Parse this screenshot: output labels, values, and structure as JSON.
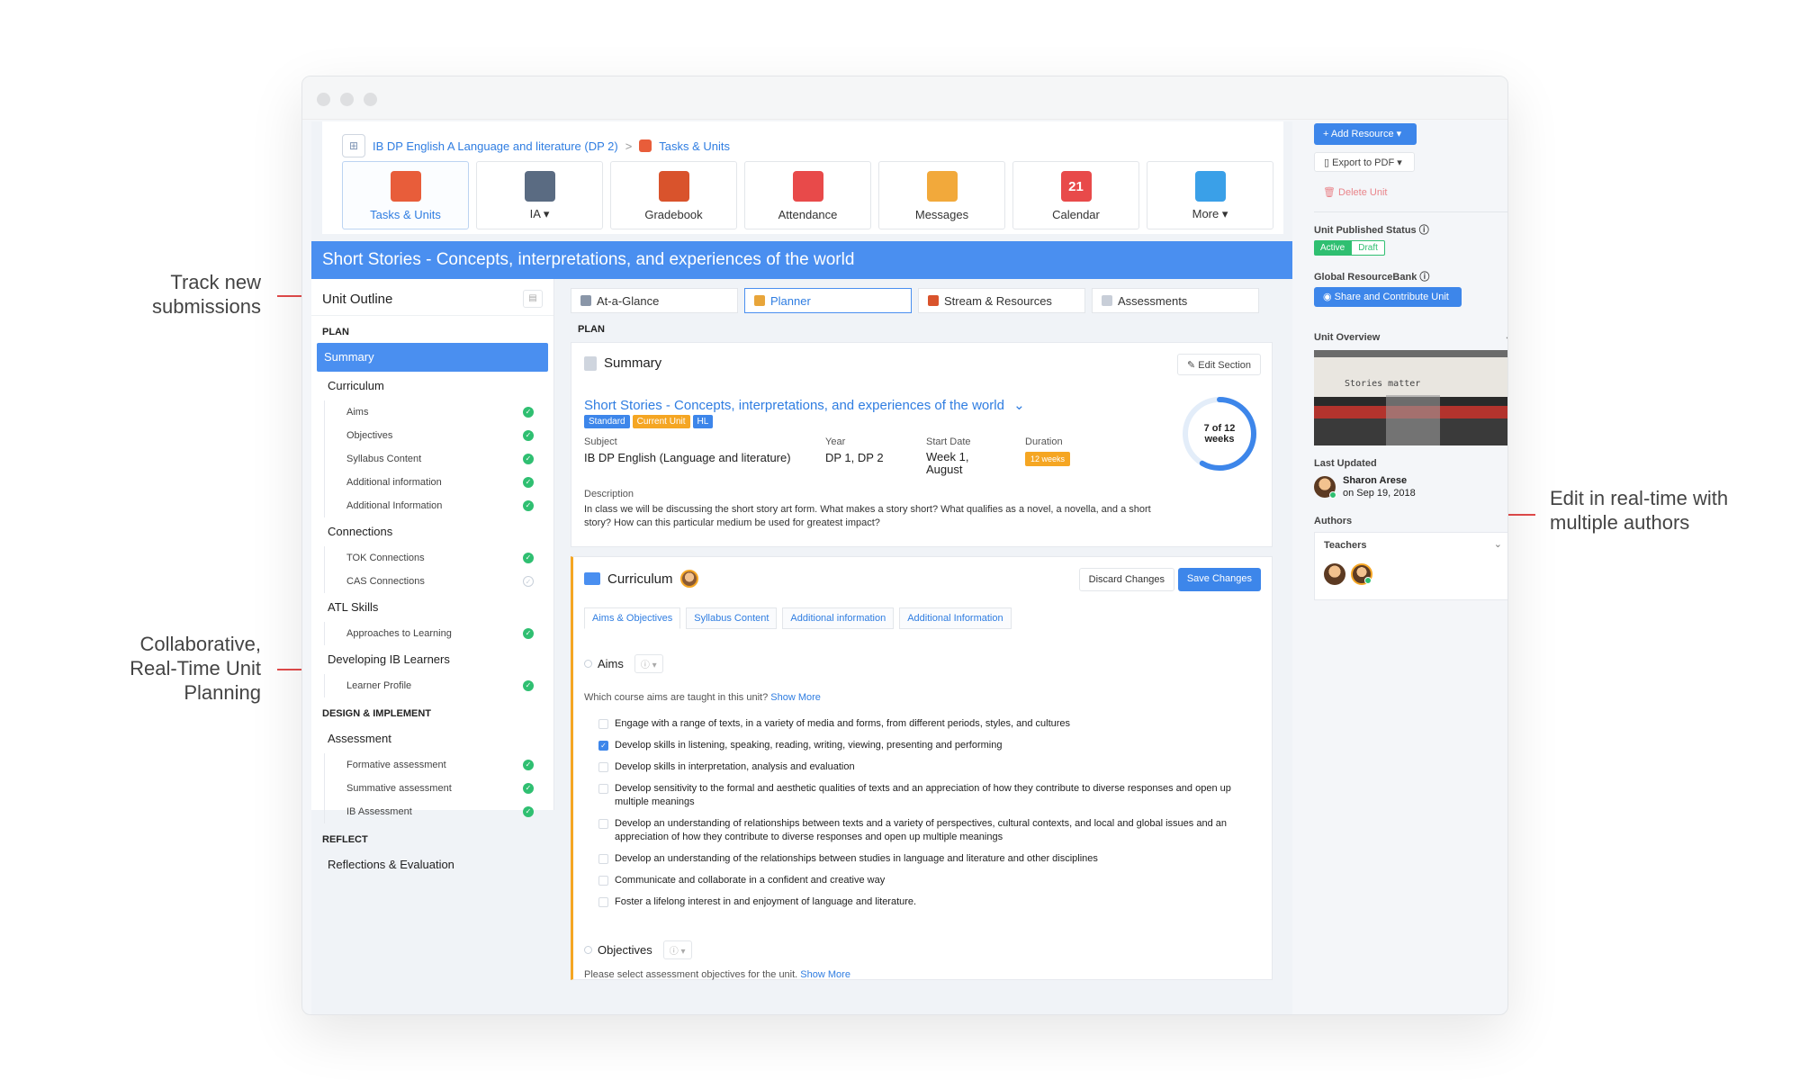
{
  "annotations": {
    "track": "Track new\nsubmissions",
    "collab": "Collaborative,\nReal-Time Unit\nPlanning",
    "edit": "Edit in real-time with\nmultiple authors"
  },
  "breadcrumb": {
    "course": "IB DP English A Language and literature (DP 2)",
    "separator": ">",
    "current": "Tasks & Units"
  },
  "nav_tiles": [
    {
      "label": "Tasks & Units",
      "icon": "puzzle-icon",
      "color": "#e85d3a",
      "active": true
    },
    {
      "label": "IA ▾",
      "icon": "notebook-icon",
      "color": "#5a6b82",
      "active": false
    },
    {
      "label": "Gradebook",
      "icon": "gradebook-icon",
      "color": "#d9532c",
      "active": false
    },
    {
      "label": "Attendance",
      "icon": "attendance-icon",
      "color": "#e84a4a",
      "active": false
    },
    {
      "label": "Messages",
      "icon": "envelope-icon",
      "color": "#f2a93b",
      "active": false
    },
    {
      "label": "Calendar",
      "icon": "calendar-icon",
      "color": "#e84a4a",
      "active": false,
      "glyph": "21"
    },
    {
      "label": "More ▾",
      "icon": "more-apps-icon",
      "color": "#3aa0e8",
      "active": false
    }
  ],
  "unit_title": "Short Stories - Concepts, interpretations, and experiences of the world",
  "outline": {
    "heading": "Unit Outline",
    "sections": [
      {
        "type": "sec",
        "label": "PLAN"
      },
      {
        "type": "item",
        "label": "Summary",
        "selected": true
      },
      {
        "type": "item",
        "label": "Curriculum"
      },
      {
        "type": "sub",
        "label": "Aims",
        "done": true
      },
      {
        "type": "sub",
        "label": "Objectives",
        "done": true
      },
      {
        "type": "sub",
        "label": "Syllabus Content",
        "done": true
      },
      {
        "type": "sub",
        "label": "Additional information",
        "done": true
      },
      {
        "type": "sub",
        "label": "Additional Information",
        "done": true
      },
      {
        "type": "item",
        "label": "Connections"
      },
      {
        "type": "sub",
        "label": "TOK Connections",
        "done": true
      },
      {
        "type": "sub",
        "label": "CAS Connections",
        "done": false
      },
      {
        "type": "item",
        "label": "ATL Skills"
      },
      {
        "type": "sub",
        "label": "Approaches to Learning",
        "done": true
      },
      {
        "type": "item",
        "label": "Developing IB Learners"
      },
      {
        "type": "sub",
        "label": "Learner Profile",
        "done": true
      },
      {
        "type": "sec",
        "label": "DESIGN & IMPLEMENT"
      },
      {
        "type": "item",
        "label": "Assessment"
      },
      {
        "type": "sub",
        "label": "Formative assessment",
        "done": true
      },
      {
        "type": "sub",
        "label": "Summative assessment",
        "done": true
      },
      {
        "type": "sub",
        "label": "IB Assessment",
        "done": true
      },
      {
        "type": "sec",
        "label": "REFLECT"
      },
      {
        "type": "item",
        "label": "Reflections & Evaluation"
      }
    ]
  },
  "content_tabs": [
    {
      "label": "At-a-Glance",
      "color": "#8a96a8",
      "active": false
    },
    {
      "label": "Planner",
      "color": "#e8a53a",
      "active": true
    },
    {
      "label": "Stream & Resources",
      "color": "#d9532c",
      "active": false
    },
    {
      "label": "Assessments",
      "color": "#c8ced8",
      "active": false
    }
  ],
  "plan_label": "PLAN",
  "summary": {
    "title": "Summary",
    "edit_label": "Edit Section",
    "unit_link": "Short Stories - Concepts, interpretations, and experiences of the world",
    "chevron": "⌄",
    "badges": [
      {
        "label": "Standard",
        "color": "#3d86ea"
      },
      {
        "label": "Current Unit",
        "color": "#f5a623"
      },
      {
        "label": "HL",
        "color": "#3d86ea"
      }
    ],
    "subject_label": "Subject",
    "subject": "IB DP English (Language and literature)",
    "year_label": "Year",
    "year": "DP 1, DP 2",
    "start_label": "Start Date",
    "start": "Week 1,\nAugust",
    "duration_label": "Duration",
    "duration": "12 weeks",
    "progress_text_1": "7 of 12",
    "progress_text_2": "weeks",
    "progress": {
      "done": 7,
      "total": 12
    },
    "description_label": "Description",
    "description": "In class we will be discussing the short story art form. What makes a story short? What qualifies as a novel, a novella, and a short story? How can this particular medium be used for greatest impact?"
  },
  "curriculum": {
    "title": "Curriculum",
    "discard_label": "Discard Changes",
    "save_label": "Save Changes",
    "tabs": [
      "Aims & Objectives",
      "Syllabus Content",
      "Additional information",
      "Additional Information"
    ],
    "aims_label": "Aims",
    "q_label": "ⓘ ▾",
    "aims_prompt": "Which course aims are taught in this unit?",
    "show_more": "Show More",
    "aims": [
      {
        "text": "Engage with a range of texts, in a variety of media and forms, from different periods, styles, and cultures",
        "checked": false
      },
      {
        "text": "Develop skills in listening, speaking, reading, writing, viewing, presenting and performing",
        "checked": true
      },
      {
        "text": "Develop skills in interpretation, analysis and evaluation",
        "checked": false
      },
      {
        "text": "Develop sensitivity to the formal and aesthetic qualities of texts and an appreciation of how they contribute to diverse responses and open up multiple meanings",
        "checked": false
      },
      {
        "text": "Develop an understanding of relationships between texts and a variety of perspectives, cultural contexts, and local and global issues and an appreciation of how they contribute to diverse responses and open up multiple meanings",
        "checked": false
      },
      {
        "text": "Develop an understanding of the relationships between studies in language and literature and other disciplines",
        "checked": false
      },
      {
        "text": "Communicate and collaborate in a confident and creative way",
        "checked": false
      },
      {
        "text": "Foster a lifelong interest in and enjoyment of language and literature.",
        "checked": false
      }
    ],
    "objectives_label": "Objectives",
    "objectives_prompt": "Please select assessment objectives for the unit."
  },
  "right_panel": {
    "add_resource": "+ Add Resource ▾",
    "export_pdf": "Export to PDF ▾",
    "delete_unit": "Delete Unit",
    "published_status_label": "Unit Published Status ⓘ",
    "status_active": "Active",
    "status_draft": "Draft",
    "resource_bank_label": "Global ResourceBank ⓘ",
    "share_label": "Share and Contribute Unit",
    "overview_label": "Unit Overview",
    "overview_image_text": "Stories matter",
    "last_updated_label": "Last Updated",
    "updated_by": "Sharon Arese",
    "updated_on": "on Sep 19, 2018",
    "authors_label": "Authors",
    "teachers_label": "Teachers"
  }
}
